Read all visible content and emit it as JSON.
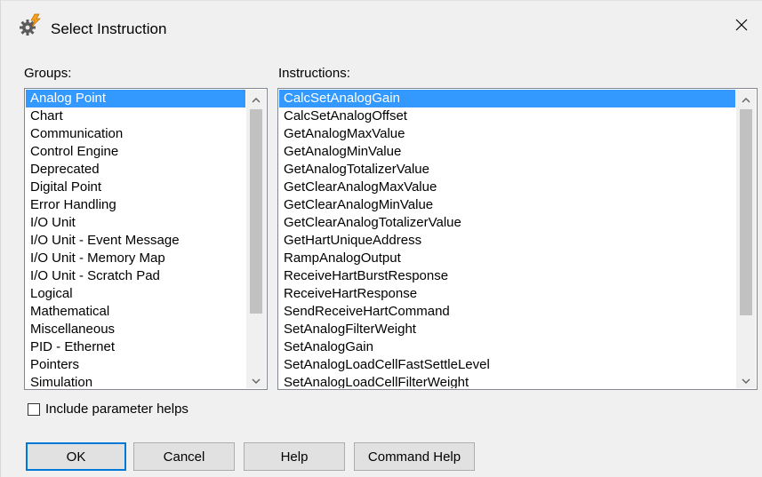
{
  "dialog": {
    "title": "Select Instruction"
  },
  "groups": {
    "label": "Groups:",
    "items": [
      "Analog Point",
      "Chart",
      "Communication",
      "Control Engine",
      "Deprecated",
      "Digital Point",
      "Error Handling",
      "I/O Unit",
      "I/O Unit - Event Message",
      "I/O Unit - Memory Map",
      "I/O Unit - Scratch Pad",
      "Logical",
      "Mathematical",
      "Miscellaneous",
      "PID - Ethernet",
      "Pointers",
      "Simulation"
    ],
    "selected": "Analog Point"
  },
  "instructions": {
    "label": "Instructions:",
    "items": [
      "CalcSetAnalogGain",
      "CalcSetAnalogOffset",
      "GetAnalogMaxValue",
      "GetAnalogMinValue",
      "GetAnalogTotalizerValue",
      "GetClearAnalogMaxValue",
      "GetClearAnalogMinValue",
      "GetClearAnalogTotalizerValue",
      "GetHartUniqueAddress",
      "RampAnalogOutput",
      "ReceiveHartBurstResponse",
      "ReceiveHartResponse",
      "SendReceiveHartCommand",
      "SetAnalogFilterWeight",
      "SetAnalogGain",
      "SetAnalogLoadCellFastSettleLevel",
      "SetAnalogLoadCellFilterWeight"
    ],
    "selected": "CalcSetAnalogGain"
  },
  "options": {
    "include_param_helps_label": "Include parameter helps",
    "include_param_helps_checked": false
  },
  "buttons": {
    "ok": "OK",
    "cancel": "Cancel",
    "help": "Help",
    "command_help": "Command Help"
  },
  "colors": {
    "selection": "#3399ff",
    "default_button_border": "#0078d7"
  },
  "icons": {
    "app": "gear-bolt-icon",
    "close": "close-icon",
    "scroll_up": "chevron-up-icon",
    "scroll_down": "chevron-down-icon"
  }
}
